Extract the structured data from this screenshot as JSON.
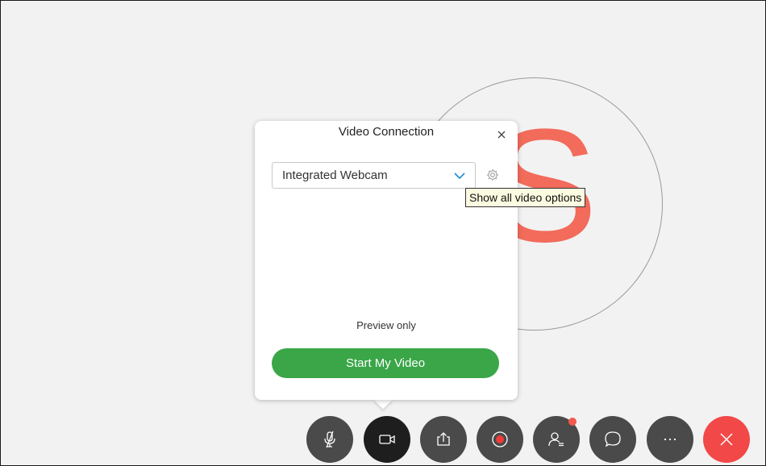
{
  "panel": {
    "title": "Video Connection",
    "camera_select_value": "Integrated Webcam",
    "preview_label": "Preview only",
    "start_button_label": "Start My Video"
  },
  "tooltip": {
    "text": "Show all video options"
  },
  "avatar": {
    "initial": "S",
    "initial_color": "#f26b5b"
  },
  "toolbar": {
    "buttons": [
      {
        "icon": "mic-muted-icon"
      },
      {
        "icon": "video-camera-icon"
      },
      {
        "icon": "share-screen-icon"
      },
      {
        "icon": "record-icon"
      },
      {
        "icon": "participants-icon",
        "has_notification": true
      },
      {
        "icon": "chat-icon"
      },
      {
        "icon": "more-icon"
      },
      {
        "icon": "leave-icon"
      }
    ]
  },
  "colors": {
    "start_button": "#3aa648",
    "end_button": "#f24848",
    "record_dot": "#f13b3b",
    "chevron": "#1d8bd1"
  }
}
